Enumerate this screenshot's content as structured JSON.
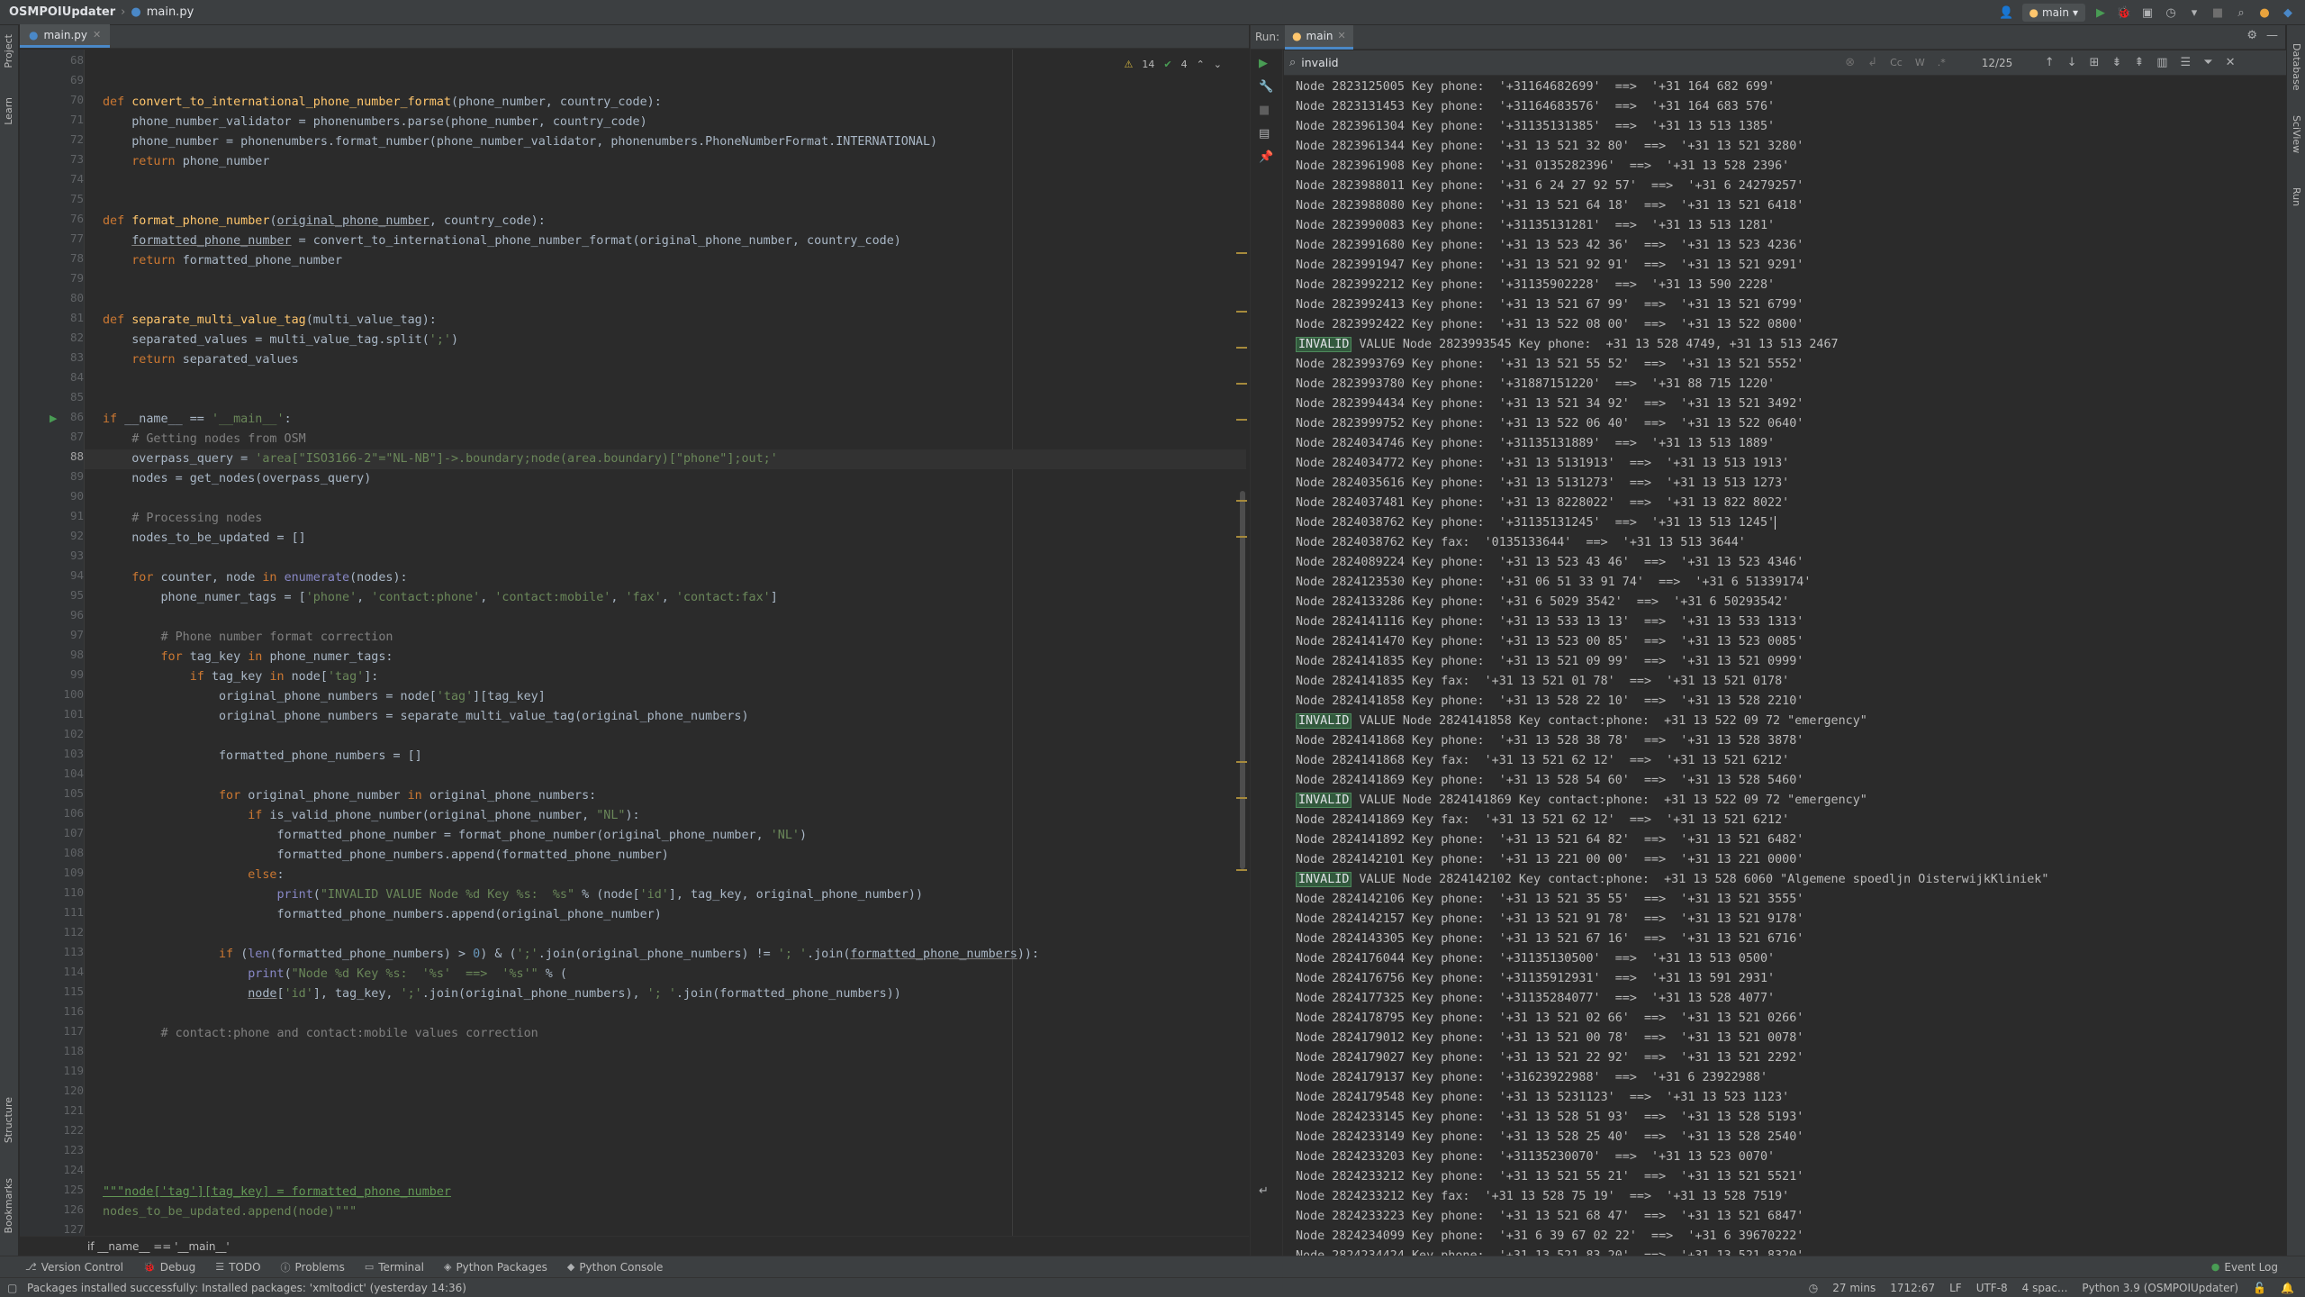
{
  "titlebar": {
    "project": "OSMPOIUpdater",
    "file": "main.py",
    "run_config": "main"
  },
  "editor": {
    "tab_label": "main.py",
    "inspections": {
      "warnings": "14",
      "ok": "4"
    },
    "bottom_breadcrumb": "if __name__ == '__main__'"
  },
  "left_strip": [
    "Project",
    "Learn",
    "Structure",
    "Bookmarks"
  ],
  "right_strip": [
    "Database",
    "SciView",
    "Run"
  ],
  "code_lines": [
    {
      "n": "68",
      "h": ""
    },
    {
      "n": "69",
      "h": ""
    },
    {
      "n": "70",
      "h": "<span class='kw'>def </span><span class='fn'>convert_to_international_phone_number_format</span>(phone_number, country_code):"
    },
    {
      "n": "71",
      "h": "    phone_number_validator = phonenumbers.parse(phone_number, country_code)"
    },
    {
      "n": "72",
      "h": "    phone_number = phonenumbers.format_number(phone_number_validator, phonenumbers.PhoneNumberFormat.INTERNATIONAL)"
    },
    {
      "n": "73",
      "h": "    <span class='kw'>return </span>phone_number"
    },
    {
      "n": "74",
      "h": ""
    },
    {
      "n": "75",
      "h": ""
    },
    {
      "n": "76",
      "h": "<span class='kw'>def </span><span class='fn'>format_phone_number</span>(<span class='ul'>original_phone_number</span>, country_code):"
    },
    {
      "n": "77",
      "h": "    <span class='ul'>formatted_phone_number</span> = convert_to_international_phone_number_format(original_phone_number, country_code)"
    },
    {
      "n": "78",
      "h": "    <span class='kw'>return </span>formatted_phone_number"
    },
    {
      "n": "79",
      "h": ""
    },
    {
      "n": "80",
      "h": ""
    },
    {
      "n": "81",
      "h": "<span class='kw'>def </span><span class='fn'>separate_multi_value_tag</span>(multi_value_tag):"
    },
    {
      "n": "82",
      "h": "    separated_values = multi_value_tag.split(<span class='st'>';'</span>)"
    },
    {
      "n": "83",
      "h": "    <span class='kw'>return </span>separated_values"
    },
    {
      "n": "84",
      "h": ""
    },
    {
      "n": "85",
      "h": ""
    },
    {
      "n": "86",
      "h": "<span class='kw'>if </span>__name__ == <span class='st'>'__main__'</span>:"
    },
    {
      "n": "87",
      "h": "    <span class='cm'># Getting nodes from OSM</span>"
    },
    {
      "n": "88",
      "h": "    overpass_query = <span class='st'>'area[\"ISO3166-2\"=\"NL-NB\"]->.boundary;node(area.boundary)[\"phone\"];out;'</span>"
    },
    {
      "n": "89",
      "h": "    nodes = get_nodes(overpass_query)"
    },
    {
      "n": "90",
      "h": ""
    },
    {
      "n": "91",
      "h": "    <span class='cm'># Processing nodes</span>"
    },
    {
      "n": "92",
      "h": "    nodes_to_be_updated = []"
    },
    {
      "n": "93",
      "h": ""
    },
    {
      "n": "94",
      "h": "    <span class='kw'>for </span>counter, node <span class='kw'>in </span><span class='bi'>enumerate</span>(nodes):"
    },
    {
      "n": "95",
      "h": "        phone_numer_tags = [<span class='st'>'phone'</span>, <span class='st'>'contact:phone'</span>, <span class='st'>'contact:mobile'</span>, <span class='st'>'fax'</span>, <span class='st'>'contact:fax'</span>]"
    },
    {
      "n": "96",
      "h": ""
    },
    {
      "n": "97",
      "h": "        <span class='cm'># Phone number format correction</span>"
    },
    {
      "n": "98",
      "h": "        <span class='kw'>for </span>tag_key <span class='kw'>in </span>phone_numer_tags:"
    },
    {
      "n": "99",
      "h": "            <span class='kw'>if </span>tag_key <span class='kw'>in </span>node[<span class='st'>'tag'</span>]:"
    },
    {
      "n": "100",
      "h": "                original_phone_numbers = node[<span class='st'>'tag'</span>][tag_key]"
    },
    {
      "n": "101",
      "h": "                original_phone_numbers = separate_multi_value_tag(original_phone_numbers)"
    },
    {
      "n": "102",
      "h": ""
    },
    {
      "n": "103",
      "h": "                formatted_phone_numbers = []"
    },
    {
      "n": "104",
      "h": ""
    },
    {
      "n": "105",
      "h": "                <span class='kw'>for </span>original_phone_number <span class='kw'>in </span>original_phone_numbers:"
    },
    {
      "n": "106",
      "h": "                    <span class='kw'>if </span>is_valid_phone_number(original_phone_number, <span class='st'>\"NL\"</span>):"
    },
    {
      "n": "107",
      "h": "                        formatted_phone_number = format_phone_number(original_phone_number, <span class='st'>'NL'</span>)"
    },
    {
      "n": "108",
      "h": "                        formatted_phone_numbers.append(formatted_phone_number)"
    },
    {
      "n": "109",
      "h": "                    <span class='kw'>else</span>:"
    },
    {
      "n": "110",
      "h": "                        <span class='bi'>print</span>(<span class='st'>\"INVALID VALUE Node %d Key %s:  %s\"</span> % (node[<span class='st'>'id'</span>], tag_key, original_phone_number))"
    },
    {
      "n": "111",
      "h": "                        formatted_phone_numbers.append(original_phone_number)"
    },
    {
      "n": "112",
      "h": ""
    },
    {
      "n": "113",
      "h": "                <span class='kw'>if </span>(<span class='bi'>len</span>(formatted_phone_numbers) > <span class='nm'>0</span>) &amp; (<span class='st'>';'</span>.join(original_phone_numbers) != <span class='st'>'; '</span>.join(<span class='ul'>formatted_phone_numbers</span>)):"
    },
    {
      "n": "114",
      "h": "                    <span class='bi'>print</span>(<span class='st'>\"Node %d Key %s:  '%s'  ==>  '%s'\"</span> % ("
    },
    {
      "n": "115",
      "h": "                    <span class='ul'>node</span>[<span class='st'>'id'</span>], tag_key, <span class='st'>';'</span>.join(original_phone_numbers), <span class='st'>'; '</span>.join(formatted_phone_numbers))"
    },
    {
      "n": "116",
      "h": ""
    },
    {
      "n": "117",
      "h": "        <span class='cm'># contact:phone and contact:mobile values correction</span>"
    },
    {
      "n": "118",
      "h": ""
    },
    {
      "n": "119",
      "h": ""
    },
    {
      "n": "120",
      "h": ""
    },
    {
      "n": "121",
      "h": ""
    },
    {
      "n": "122",
      "h": ""
    },
    {
      "n": "123",
      "h": ""
    },
    {
      "n": "124",
      "h": ""
    },
    {
      "n": "125",
      "h": "<span class='st-ul'>\"\"\"node['tag'][tag_key] = formatted_phone_number</span>"
    },
    {
      "n": "126",
      "h": "<span class='st'>nodes_to_be_updated.append(node)\"\"\"</span>"
    },
    {
      "n": "127",
      "h": ""
    }
  ],
  "run": {
    "label": "Run:",
    "tab": "main",
    "find_text": "invalid",
    "find_opts": [
      "Cc",
      "W",
      ".*"
    ],
    "match_count": "12/25",
    "lines": [
      "Node 2823125005 Key phone:  '+31164682699'  ==>  '+31 164 682 699'",
      "Node 2823131453 Key phone:  '+31164683576'  ==>  '+31 164 683 576'",
      "Node 2823961304 Key phone:  '+31135131385'  ==>  '+31 13 513 1385'",
      "Node 2823961344 Key phone:  '+31 13 521 32 80'  ==>  '+31 13 521 3280'",
      "Node 2823961908 Key phone:  '+31 0135282396'  ==>  '+31 13 528 2396'",
      "Node 2823988011 Key phone:  '+31 6 24 27 92 57'  ==>  '+31 6 24279257'",
      "Node 2823988080 Key phone:  '+31 13 521 64 18'  ==>  '+31 13 521 6418'",
      "Node 2823990083 Key phone:  '+31135131281'  ==>  '+31 13 513 1281'",
      "Node 2823991680 Key phone:  '+31 13 523 42 36'  ==>  '+31 13 523 4236'",
      "Node 2823991947 Key phone:  '+31 13 521 92 91'  ==>  '+31 13 521 9291'",
      "Node 2823992212 Key phone:  '+31135902228'  ==>  '+31 13 590 2228'",
      "Node 2823992413 Key phone:  '+31 13 521 67 99'  ==>  '+31 13 521 6799'",
      "Node 2823992422 Key phone:  '+31 13 522 08 00'  ==>  '+31 13 522 0800'",
      "INVALID| VALUE Node 2823993545 Key phone:  +31 13 528 4749, +31 13 513 2467",
      "Node 2823993769 Key phone:  '+31 13 521 55 52'  ==>  '+31 13 521 5552'",
      "Node 2823993780 Key phone:  '+31887151220'  ==>  '+31 88 715 1220'",
      "Node 2823994434 Key phone:  '+31 13 521 34 92'  ==>  '+31 13 521 3492'",
      "Node 2823999752 Key phone:  '+31 13 522 06 40'  ==>  '+31 13 522 0640'",
      "Node 2824034746 Key phone:  '+31135131889'  ==>  '+31 13 513 1889'",
      "Node 2824034772 Key phone:  '+31 13 5131913'  ==>  '+31 13 513 1913'",
      "Node 2824035616 Key phone:  '+31 13 5131273'  ==>  '+31 13 513 1273'",
      "Node 2824037481 Key phone:  '+31 13 8228022'  ==>  '+31 13 822 8022'",
      "Node 2824038762 Key phone:  '+31135131245'  ==>  '+31 13 513 1245'",
      "Node 2824038762 Key fax:  '0135133644'  ==>  '+31 13 513 3644'",
      "Node 2824089224 Key phone:  '+31 13 523 43 46'  ==>  '+31 13 523 4346'",
      "Node 2824123530 Key phone:  '+31 06 51 33 91 74'  ==>  '+31 6 51339174'",
      "Node 2824133286 Key phone:  '+31 6 5029 3542'  ==>  '+31 6 50293542'",
      "Node 2824141116 Key phone:  '+31 13 533 13 13'  ==>  '+31 13 533 1313'",
      "Node 2824141470 Key phone:  '+31 13 523 00 85'  ==>  '+31 13 523 0085'",
      "Node 2824141835 Key phone:  '+31 13 521 09 99'  ==>  '+31 13 521 0999'",
      "Node 2824141835 Key fax:  '+31 13 521 01 78'  ==>  '+31 13 521 0178'",
      "Node 2824141858 Key phone:  '+31 13 528 22 10'  ==>  '+31 13 528 2210'",
      "INVALID| VALUE Node 2824141858 Key contact:phone:  +31 13 522 09 72 \"emergency\"",
      "Node 2824141868 Key phone:  '+31 13 528 38 78'  ==>  '+31 13 528 3878'",
      "Node 2824141868 Key fax:  '+31 13 521 62 12'  ==>  '+31 13 521 6212'",
      "Node 2824141869 Key phone:  '+31 13 528 54 60'  ==>  '+31 13 528 5460'",
      "INVALID| VALUE Node 2824141869 Key contact:phone:  +31 13 522 09 72 \"emergency\"",
      "Node 2824141869 Key fax:  '+31 13 521 62 12'  ==>  '+31 13 521 6212'",
      "Node 2824141892 Key phone:  '+31 13 521 64 82'  ==>  '+31 13 521 6482'",
      "Node 2824142101 Key phone:  '+31 13 221 00 00'  ==>  '+31 13 221 0000'",
      "INVALID| VALUE Node 2824142102 Key contact:phone:  +31 13 528 6060 \"Algemene spoedljn OisterwijkKliniek\"",
      "Node 2824142106 Key phone:  '+31 13 521 35 55'  ==>  '+31 13 521 3555'",
      "Node 2824142157 Key phone:  '+31 13 521 91 78'  ==>  '+31 13 521 9178'",
      "Node 2824143305 Key phone:  '+31 13 521 67 16'  ==>  '+31 13 521 6716'",
      "Node 2824176044 Key phone:  '+31135130500'  ==>  '+31 13 513 0500'",
      "Node 2824176756 Key phone:  '+31135912931'  ==>  '+31 13 591 2931'",
      "Node 2824177325 Key phone:  '+31135284077'  ==>  '+31 13 528 4077'",
      "Node 2824178795 Key phone:  '+31 13 521 02 66'  ==>  '+31 13 521 0266'",
      "Node 2824179012 Key phone:  '+31 13 521 00 78'  ==>  '+31 13 521 0078'",
      "Node 2824179027 Key phone:  '+31 13 521 22 92'  ==>  '+31 13 521 2292'",
      "Node 2824179137 Key phone:  '+31623922988'  ==>  '+31 6 23922988'",
      "Node 2824179548 Key phone:  '+31 13 5231123'  ==>  '+31 13 523 1123'",
      "Node 2824233145 Key phone:  '+31 13 528 51 93'  ==>  '+31 13 528 5193'",
      "Node 2824233149 Key phone:  '+31 13 528 25 40'  ==>  '+31 13 528 2540'",
      "Node 2824233203 Key phone:  '+31135230070'  ==>  '+31 13 523 0070'",
      "Node 2824233212 Key phone:  '+31 13 521 55 21'  ==>  '+31 13 521 5521'",
      "Node 2824233212 Key fax:  '+31 13 528 75 19'  ==>  '+31 13 528 7519'",
      "Node 2824233223 Key phone:  '+31 13 521 68 47'  ==>  '+31 13 521 6847'",
      "Node 2824234099 Key phone:  '+31 6 39 67 02 22'  ==>  '+31 6 39670222'",
      "Node 2824234424 Key phone:  '+31 13 521 83 20'  ==>  '+31 13 521 8320'"
    ]
  },
  "bottom_tools": [
    "Version Control",
    "Debug",
    "TODO",
    "Problems",
    "Terminal",
    "Python Packages",
    "Python Console"
  ],
  "event_log": "Event Log",
  "status": {
    "message": "Packages installed successfully: Installed packages: 'xmltodict' (yesterday 14:36)",
    "time": "27 mins",
    "position": "1712:67",
    "line_sep": "LF",
    "encoding": "UTF-8",
    "indent": "4 spac...",
    "interpreter": "Python 3.9 (OSMPOIUpdater)"
  },
  "colors": {
    "accent": "#4a88c7",
    "highlight": "#32593d",
    "run_green": "#499c54"
  }
}
